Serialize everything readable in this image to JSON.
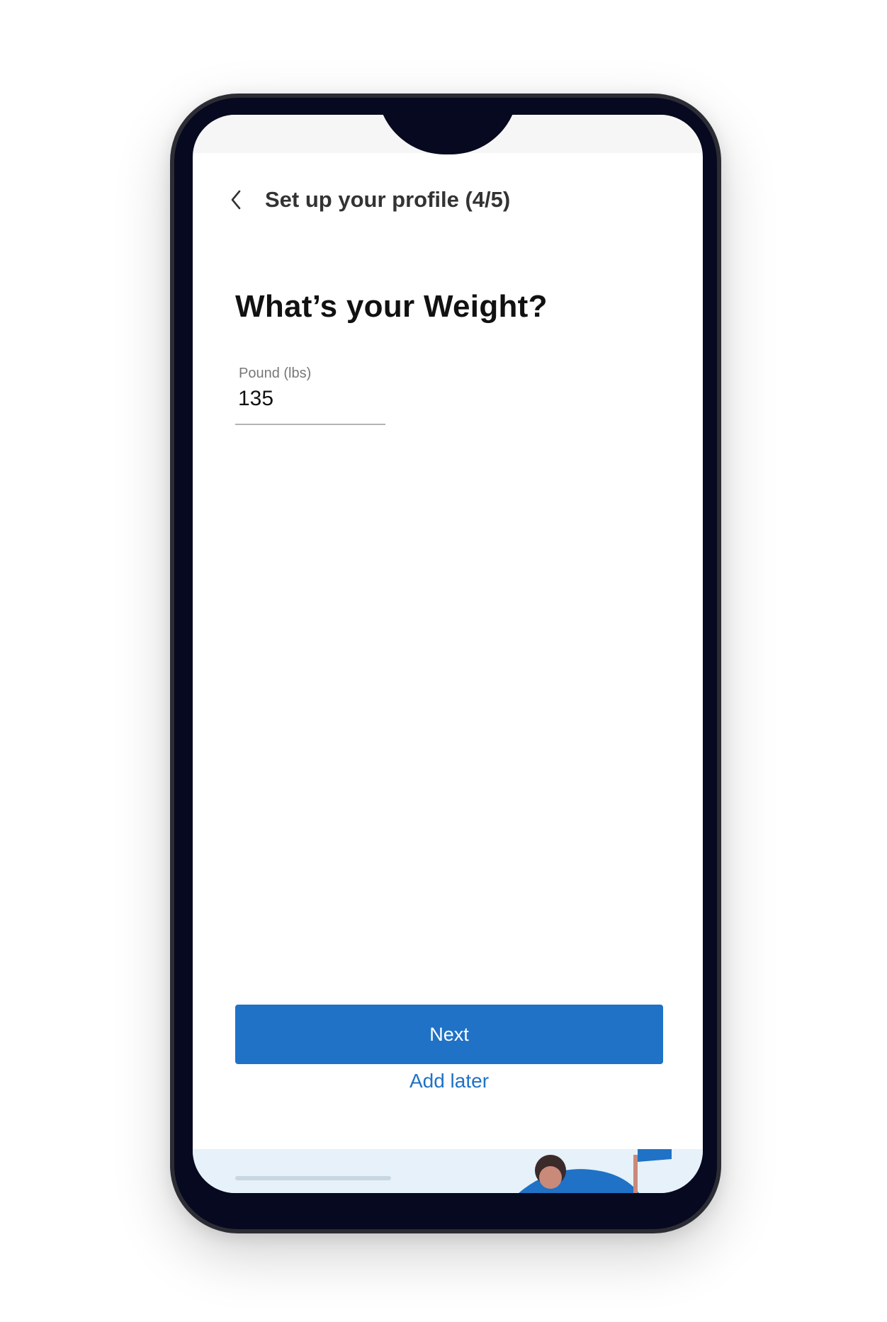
{
  "header": {
    "title": "Set up your profile (4/5)",
    "back_icon": "chevron-left-icon"
  },
  "main": {
    "question": "What’s your Weight?",
    "weight_field": {
      "label": "Pound (lbs)",
      "value": "135"
    }
  },
  "actions": {
    "next_label": "Next",
    "add_later_label": "Add later"
  },
  "colors": {
    "accent": "#1f72c6",
    "phone_frame": "#06091f",
    "text_primary": "#111111",
    "text_secondary": "#777777"
  }
}
